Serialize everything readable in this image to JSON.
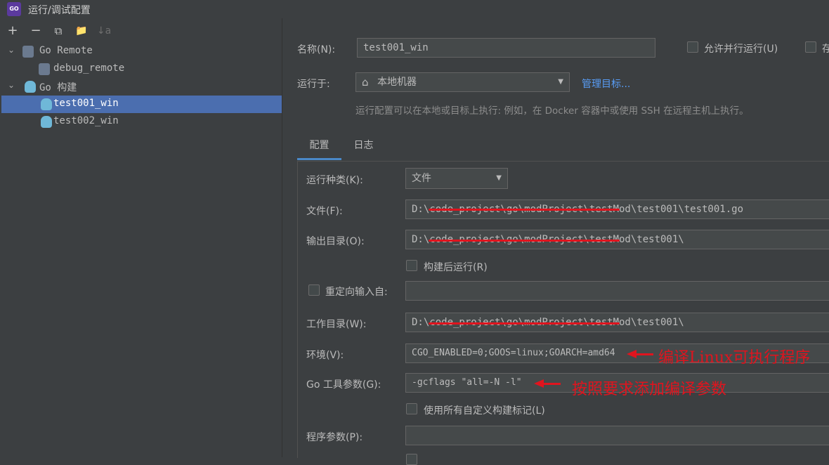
{
  "window": {
    "title": "运行/调试配置",
    "logo_text": "GO"
  },
  "toolbar": {
    "add": "+",
    "remove": "−",
    "copy": "⧉",
    "folder": "📁",
    "sort": "↓a"
  },
  "tree": {
    "items": [
      {
        "label": "Go Remote",
        "type": "group"
      },
      {
        "label": "debug_remote",
        "type": "remote"
      },
      {
        "label": "Go 构建",
        "type": "group"
      },
      {
        "label": "test001_win",
        "type": "gopher",
        "selected": true
      },
      {
        "label": "test002_win",
        "type": "gopher"
      }
    ]
  },
  "header": {
    "name_label": "名称(N):",
    "name_value": "test001_win",
    "allow_parallel_label": "允许并行运行(U)",
    "store_label": "存",
    "run_on_label": "运行于:",
    "run_on_value": "本地机器",
    "manage_targets": "管理目标...",
    "hint": "运行配置可以在本地或目标上执行: 例如，在 Docker 容器中或使用 SSH 在远程主机上执行。"
  },
  "tabs": [
    {
      "label": "配置",
      "active": true
    },
    {
      "label": "日志",
      "active": false
    }
  ],
  "form": {
    "run_kind_label": "运行种类(K):",
    "run_kind_value": "文件",
    "file_label": "文件(F):",
    "file_value": "D:\\code_project\\go\\modProject\\testMod\\test001\\test001.go",
    "output_label": "输出目录(O):",
    "output_value": "D:\\code_project\\go\\modProject\\testMod\\test001\\",
    "run_after_build": "构建后运行(R)",
    "redirect_input": "重定向输入自:",
    "workdir_label": "工作目录(W):",
    "workdir_value": "D:\\code_project\\go\\modProject\\testMod\\test001\\",
    "env_label": "环境(V):",
    "env_value": "CGO_ENABLED=0;GOOS=linux;GOARCH=amd64",
    "go_tool_args_label": "Go 工具参数(G):",
    "go_tool_args_value": "-gcflags \"all=-N -l\"",
    "use_custom_tags": "使用所有自定义构建标记(L)",
    "program_args_label": "程序参数(P):"
  },
  "annotations": {
    "env_note": "编译Linux可执行程序",
    "args_note": "按照要求添加编译参数"
  },
  "colors": {
    "selection": "#4b6eaf",
    "accent": "#4a88c7",
    "annotation": "#e0141e",
    "link": "#589df6"
  }
}
